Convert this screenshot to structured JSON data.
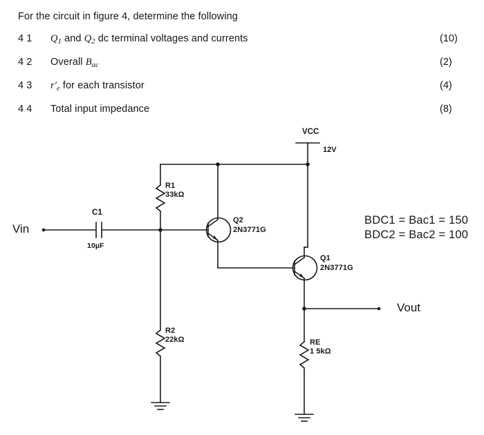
{
  "document": {
    "intro": "For the circuit in figure 4, determine the following",
    "questions": [
      {
        "number": "4 1",
        "text_parts": {
          "pre": "",
          "q1": "Q",
          "q1sub": "1",
          "mid": " and ",
          "q2": "Q",
          "q2sub": "2",
          "post": " dc terminal voltages and currents"
        },
        "plain_text": "Q1 and Q2 dc terminal voltages and currents",
        "marks": "(10)"
      },
      {
        "number": "4 2",
        "text_parts": {
          "pre": "Overall ",
          "sym": "B",
          "symsub": "ac",
          "post": ""
        },
        "plain_text": "Overall Bac",
        "marks": "(2)"
      },
      {
        "number": "4 3",
        "text_parts": {
          "pre": "",
          "sym": "r'",
          "symsub": "e",
          "post": " for each transistor"
        },
        "plain_text": "r'e for each transistor",
        "marks": "(4)"
      },
      {
        "number": "4 4",
        "text_parts": {
          "pre": "Total input impedance",
          "sym": "",
          "symsub": "",
          "post": ""
        },
        "plain_text": "Total input impedance",
        "marks": "(8)"
      }
    ]
  },
  "schematic": {
    "supply": {
      "name": "VCC",
      "value": "12V"
    },
    "input_terminal": "Vin",
    "output_terminal": "Vout",
    "capacitor": {
      "ref": "C1",
      "value": "10µF"
    },
    "resistors": [
      {
        "ref": "R1",
        "value": "33kΩ"
      },
      {
        "ref": "R2",
        "value": "22kΩ"
      },
      {
        "ref": "RE",
        "value": "1 5kΩ"
      }
    ],
    "transistors": [
      {
        "ref": "Q2",
        "part": "2N3771G"
      },
      {
        "ref": "Q1",
        "part": "2N3771G"
      }
    ],
    "annotations": [
      "BDC1 = Bac1 = 150",
      "BDC2 = Bac2 = 100"
    ],
    "stroke_color": "#1a1a1a"
  }
}
